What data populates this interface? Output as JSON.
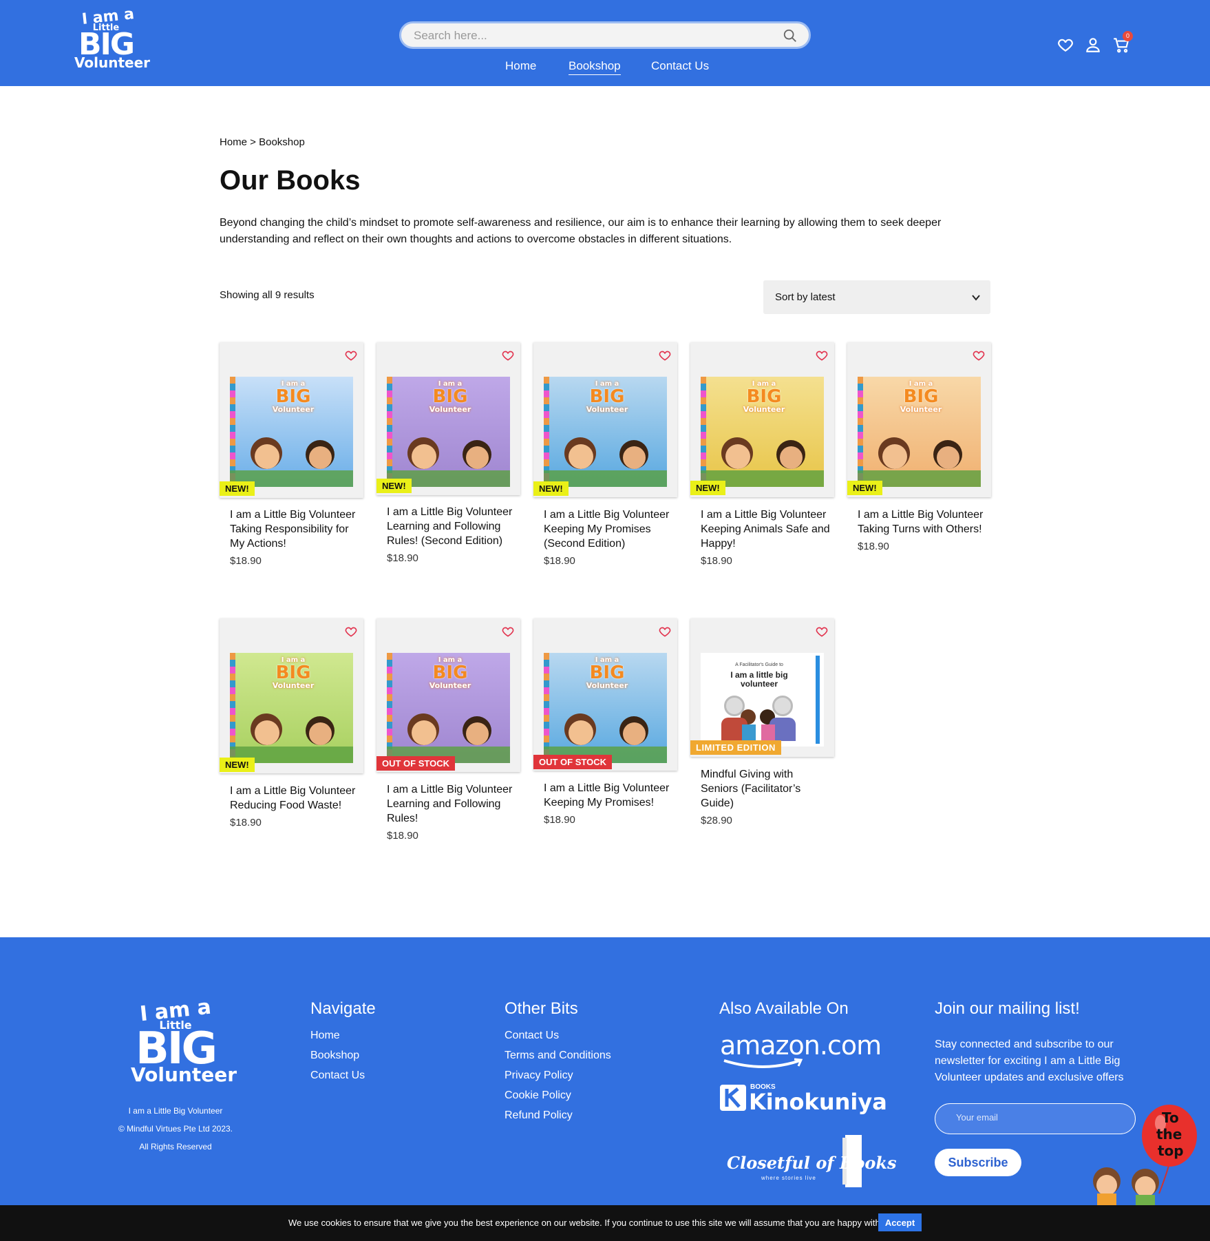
{
  "header": {
    "logo": {
      "line1": "I am a",
      "line2": "Little",
      "line3": "BIG",
      "line4": "Volunteer"
    },
    "search_placeholder": "Search here...",
    "nav": [
      "Home",
      "Bookshop",
      "Contact Us"
    ],
    "active_nav": "Bookshop",
    "cart_count": "0",
    "icons": [
      "heart-icon",
      "user-icon",
      "cart-icon",
      "search-icon"
    ]
  },
  "breadcrumb": "Home > Bookshop",
  "page_title": "Our Books",
  "intro": "Beyond changing the child’s mindset to promote self-awareness and resilience, our aim is to enhance their learning by allowing them to seek deeper understanding and reflect on their own thoughts and actions to overcome obstacles in different situations.",
  "results_text": "Showing all 9 results",
  "sort_label": "Sort by latest",
  "products": [
    {
      "title": "I am a Little Big Volunteer Taking Responsibility for My Actions!",
      "price": "$18.90",
      "badge": "NEW!"
    },
    {
      "title": "I am a Little Big Volunteer Learning and Following Rules! (Second Edition)",
      "price": "$18.90",
      "badge": "NEW!"
    },
    {
      "title": "I am a Little Big Volunteer Keeping My Promises (Second Edition)",
      "price": "$18.90",
      "badge": "NEW!"
    },
    {
      "title": "I am a Little Big Volunteer Keeping Animals Safe and Happy!",
      "price": "$18.90",
      "badge": "NEW!"
    },
    {
      "title": "I am a Little Big Volunteer Taking Turns with Others!",
      "price": "$18.90",
      "badge": "NEW!"
    },
    {
      "title": "I am a Little Big Volunteer Reducing Food Waste!",
      "price": "$18.90",
      "badge": "NEW!"
    },
    {
      "title": "I am a Little Big Volunteer Learning and Following Rules!",
      "price": "$18.90",
      "badge": "OUT OF STOCK"
    },
    {
      "title": "I am a Little Big Volunteer Keeping My Promises!",
      "price": "$18.90",
      "badge": "OUT OF STOCK"
    },
    {
      "title": "Mindful Giving with Seniors (Facilitator’s Guide)",
      "price": "$28.90",
      "badge": "LIMITED EDITION"
    }
  ],
  "cover_text": {
    "l1": "I am a",
    "l2": "BIG",
    "l3": "Volunteer"
  },
  "facilitator_cover": {
    "small": "A Facilitator's Guide to",
    "title": "I am a little big volunteer"
  },
  "colors": {
    "brand_blue": "#3270e0",
    "new_badge": "#eaf018",
    "oos_badge": "#e0353a",
    "limited_badge": "#f0a830",
    "heart": "#e2344f"
  },
  "footer": {
    "logo": {
      "line1": "I am a",
      "line2": "Little",
      "line3": "BIG",
      "line4": "Volunteer"
    },
    "company_lines": [
      "I am a Little Big Volunteer",
      "© Mindful Virtues Pte Ltd 2023.",
      "All Rights Reserved"
    ],
    "navigate_heading": "Navigate",
    "navigate_links": [
      "Home",
      "Bookshop",
      "Contact Us"
    ],
    "other_heading": "Other Bits",
    "other_links": [
      "Contact Us",
      "Terms and Conditions",
      "Privacy Policy",
      "Cookie Policy",
      "Refund Policy"
    ],
    "available_heading": "Also Available On",
    "stores": {
      "amazon": "amazon.com",
      "kino_small": "BOOKS",
      "kino": "Kinokuniya",
      "closet": "Closetful of Books",
      "closet_tag": "where stories live"
    },
    "mailing_heading": "Join our mailing list!",
    "mailing_text": "Stay connected and subscribe to our newsletter for exciting I am a Little Big Volunteer updates and exclusive offers",
    "email_placeholder": "Your email",
    "subscribe_label": "Subscribe"
  },
  "to_top": {
    "l1": "To",
    "l2": "the",
    "l3": "top"
  },
  "cookie": {
    "text": "We use cookies to ensure that we give you the best experience on our website. If you continue to use this site we will assume that you are happy with it.",
    "accept": "Accept"
  }
}
